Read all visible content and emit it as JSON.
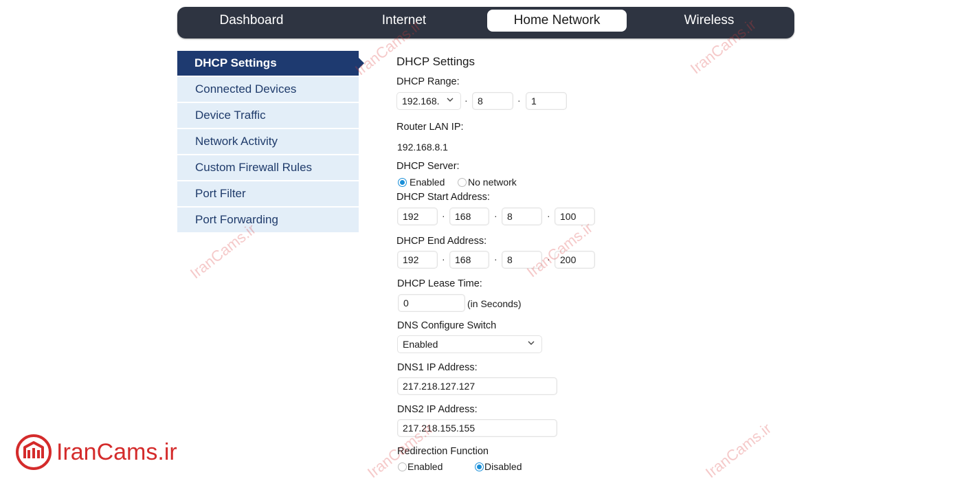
{
  "nav": {
    "tabs": [
      {
        "label": "Dashboard"
      },
      {
        "label": "Internet"
      },
      {
        "label": "Home Network"
      },
      {
        "label": "Wireless"
      }
    ],
    "active_tab": "Home Network"
  },
  "sidebar": {
    "items": [
      {
        "label": "DHCP Settings"
      },
      {
        "label": "Connected Devices"
      },
      {
        "label": "Device Traffic"
      },
      {
        "label": "Network Activity"
      },
      {
        "label": "Custom Firewall Rules"
      },
      {
        "label": "Port Filter"
      },
      {
        "label": "Port Forwarding"
      }
    ],
    "active_item": "DHCP Settings"
  },
  "form": {
    "title": "DHCP Settings",
    "dhcp_range": {
      "label": "DHCP Range:",
      "prefix_select": "192.168.",
      "octet3": "8",
      "octet4": "1",
      "separator": "·"
    },
    "router_lan_ip": {
      "label": "Router LAN IP:",
      "value": "192.168.8.1"
    },
    "dhcp_server": {
      "label": "DHCP Server:",
      "options": [
        "Enabled",
        "No network"
      ],
      "selected": "Enabled"
    },
    "start_address": {
      "label": "DHCP Start Address:",
      "octets": [
        "192",
        "168",
        "8",
        "100"
      ]
    },
    "end_address": {
      "label": "DHCP End Address:",
      "octets": [
        "192",
        "168",
        "8",
        "200"
      ]
    },
    "lease_time": {
      "label": "DHCP Lease Time:",
      "value": "0",
      "unit": "(in Seconds)"
    },
    "dns_switch": {
      "label": "DNS Configure Switch",
      "value": "Enabled"
    },
    "dns1": {
      "label": "DNS1 IP Address:",
      "value": "217.218.127.127"
    },
    "dns2": {
      "label": "DNS2 IP Address:",
      "value": "217.218.155.155"
    },
    "redirection": {
      "label": "Redirection Function",
      "options": [
        "Enabled",
        "Disabled"
      ],
      "selected": "Disabled"
    }
  },
  "watermark": {
    "text": "IranCams.ir",
    "color": "#d42b2b"
  },
  "colors": {
    "navbar": "#2e3441",
    "sidebar_active": "#1e3a70",
    "sidebar_item": "#e3eef8",
    "radio_accent": "#1a8fd8"
  }
}
